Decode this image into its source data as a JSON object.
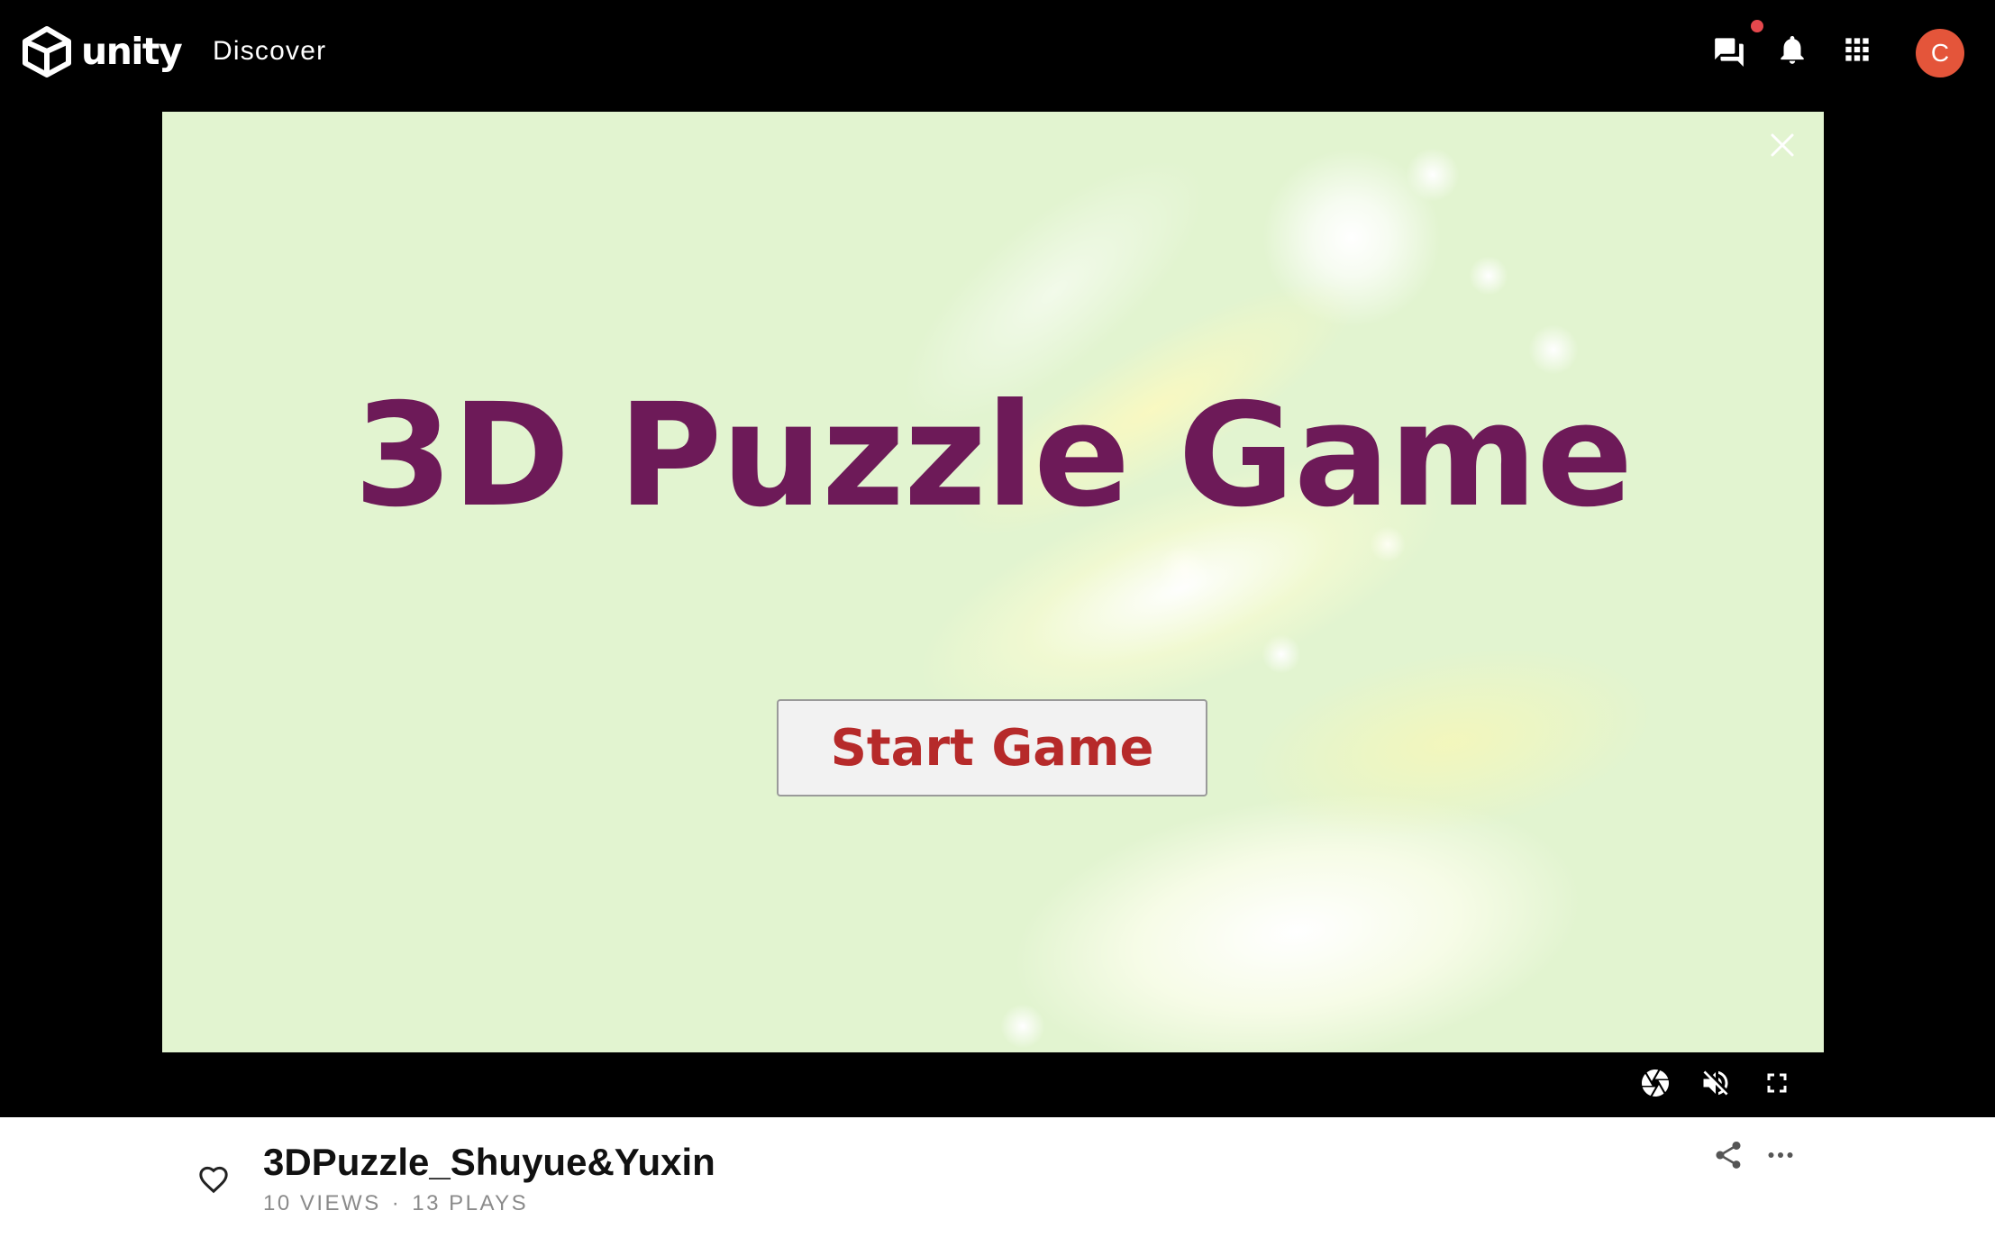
{
  "header": {
    "logo_text": "unity",
    "nav_discover": "Discover",
    "avatar_initial": "C",
    "notification_dot_color": "#e5484d",
    "avatar_color": "#e4553a"
  },
  "game": {
    "title": "3D Puzzle Game",
    "start_button": "Start Game",
    "title_color": "#6d1a58",
    "button_text_color": "#b62a2a",
    "background_color": "#e2f4d0"
  },
  "player_controls": [
    "screenshot-icon",
    "mute-icon",
    "fullscreen-icon"
  ],
  "project": {
    "title": "3DPuzzle_Shuyue&Yuxin",
    "views": "10 VIEWS",
    "separator": "·",
    "plays": "13 PLAYS"
  }
}
